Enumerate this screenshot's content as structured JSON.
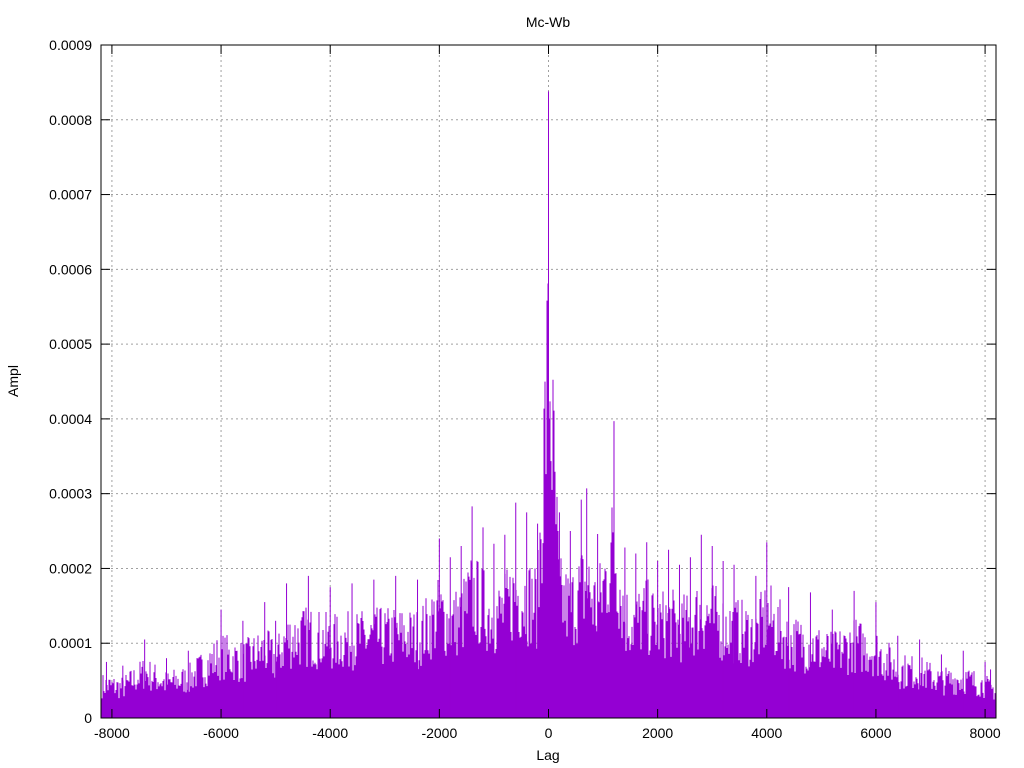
{
  "chart_data": {
    "type": "bar",
    "title": "Mc-Wb",
    "xlabel": "Lag",
    "ylabel": "Ampl",
    "xlim": [
      -8200,
      8200
    ],
    "ylim": [
      0,
      0.0009
    ],
    "grid": true,
    "x_ticks": [
      -8000,
      -6000,
      -4000,
      -2000,
      0,
      2000,
      4000,
      6000,
      8000
    ],
    "x_tick_labels": [
      "-8000",
      "-6000",
      "-4000",
      "-2000",
      "0",
      "2000",
      "4000",
      "6000",
      "8000"
    ],
    "y_ticks": [
      0,
      0.0001,
      0.0002,
      0.0003,
      0.0004,
      0.0005,
      0.0006,
      0.0007,
      0.0008,
      0.0009
    ],
    "y_tick_labels": [
      "0",
      "0.0001",
      "0.0002",
      "0.0003",
      "0.0004",
      "0.0005",
      "0.0006",
      "0.0007",
      "0.0008",
      "0.0009"
    ],
    "series": [
      {
        "color": "#9400d3",
        "style": "impulses",
        "x": [
          -8100,
          -7800,
          -7400,
          -7000,
          -6600,
          -6000,
          -5600,
          -5200,
          -5000,
          -4800,
          -4400,
          -4000,
          -3600,
          -3200,
          -2800,
          -2400,
          -2000,
          -1800,
          -1600,
          -1400,
          -1200,
          -1000,
          -800,
          -600,
          -400,
          -200,
          0,
          200,
          400,
          600,
          700,
          900,
          1200,
          1400,
          1600,
          1800,
          2000,
          2200,
          2400,
          2600,
          2800,
          3000,
          3200,
          3400,
          3800,
          4000,
          4400,
          4800,
          5200,
          5600,
          6000,
          6400,
          6800,
          7200,
          7600,
          8000,
          8100
        ],
        "values": [
          7.5e-05,
          7e-05,
          0.000105,
          8e-05,
          9e-05,
          0.000145,
          0.00013,
          0.000155,
          0.00013,
          0.00018,
          0.00019,
          0.000175,
          0.00018,
          0.000185,
          0.00019,
          0.000185,
          0.00024,
          0.000215,
          0.00023,
          0.000283,
          0.000255,
          0.000233,
          0.000245,
          0.000288,
          0.000275,
          0.00026,
          0.000838,
          0.000275,
          0.00025,
          0.000292,
          0.000307,
          0.000246,
          0.000397,
          0.000228,
          0.00022,
          0.000235,
          0.00021,
          0.000225,
          0.000205,
          0.000215,
          0.000245,
          0.00023,
          0.00021,
          0.000205,
          0.00019,
          0.000235,
          0.000175,
          0.000168,
          0.000145,
          0.00017,
          0.000155,
          0.00011,
          0.000105,
          8.5e-05,
          9e-05,
          7.5e-05,
          6.5e-05
        ]
      }
    ]
  }
}
